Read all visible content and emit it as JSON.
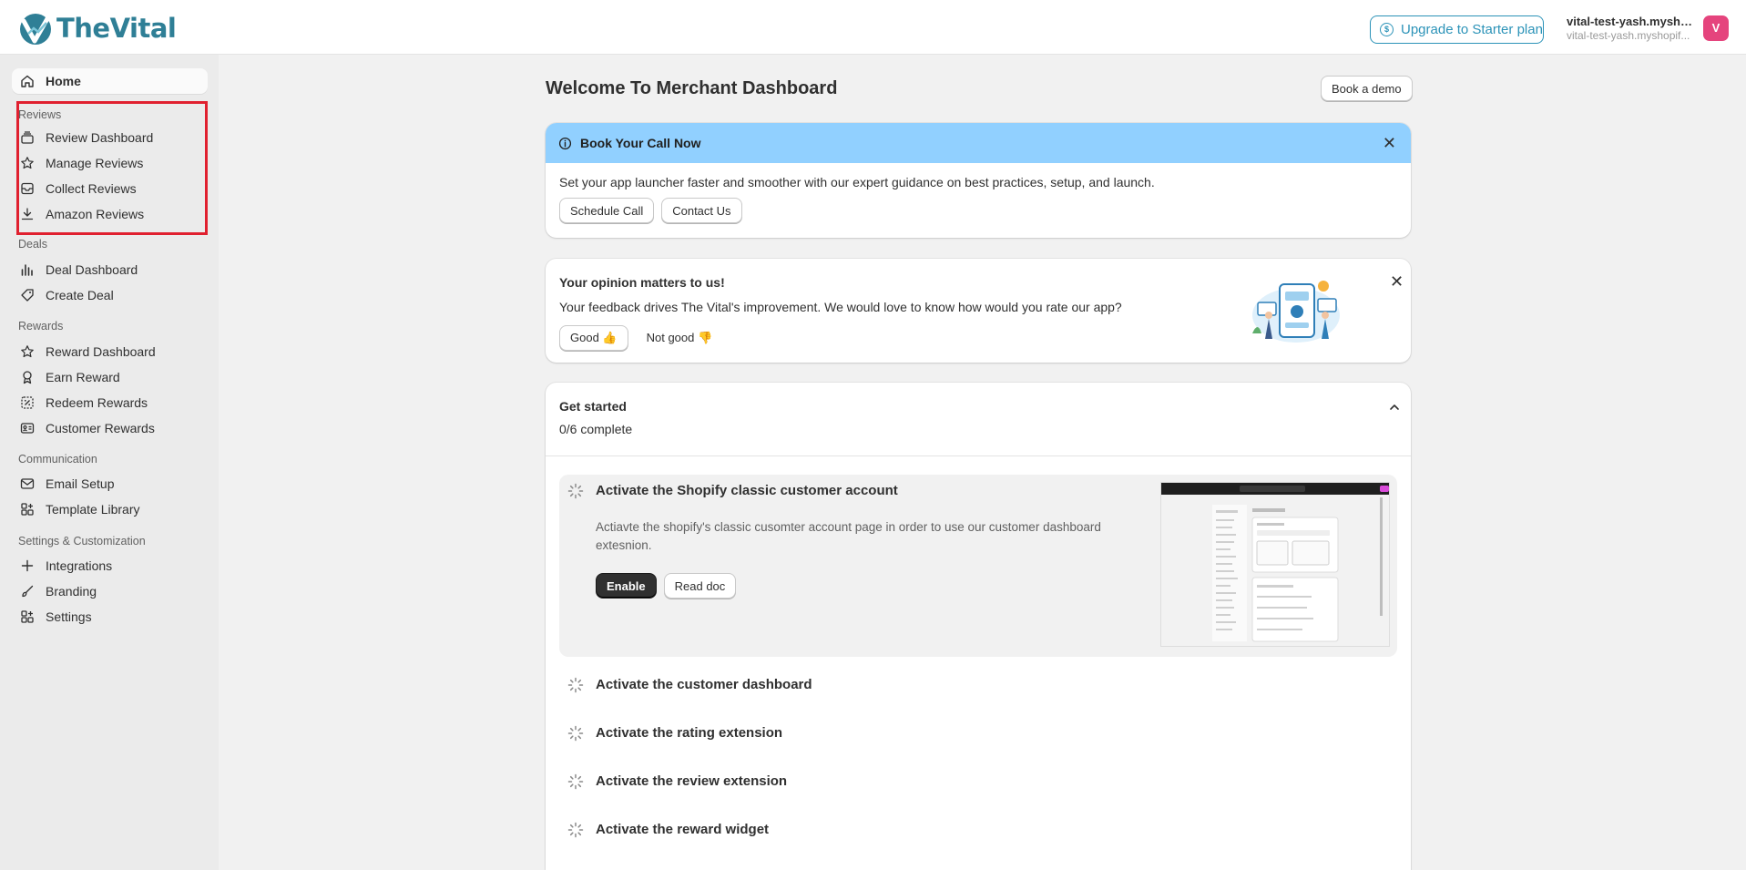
{
  "header": {
    "brand": "TheVital",
    "upgrade_label": "Upgrade to Starter plan",
    "store_name": "vital-test-yash.mysho...",
    "store_domain": "vital-test-yash.myshopif...",
    "avatar_initial": "V"
  },
  "sidebar": {
    "home": "Home",
    "reviews_section": "Reviews",
    "review_dashboard": "Review Dashboard",
    "manage_reviews": "Manage Reviews",
    "collect_reviews": "Collect Reviews",
    "amazon_reviews": "Amazon Reviews",
    "deals_section": "Deals",
    "deal_dashboard": "Deal Dashboard",
    "create_deal": "Create Deal",
    "rewards_section": "Rewards",
    "reward_dashboard": "Reward Dashboard",
    "earn_reward": "Earn Reward",
    "redeem_rewards": "Redeem Rewards",
    "customer_rewards": "Customer Rewards",
    "communication_section": "Communication",
    "email_setup": "Email Setup",
    "template_library": "Template Library",
    "settings_section": "Settings & Customization",
    "integrations": "Integrations",
    "branding": "Branding",
    "settings": "Settings"
  },
  "main": {
    "title": "Welcome To Merchant Dashboard",
    "book_demo": "Book a demo",
    "banner": {
      "title": "Book Your Call Now",
      "text": "Set your app launcher faster and smoother with our expert guidance on best practices, setup, and launch.",
      "schedule_call": "Schedule Call",
      "contact_us": "Contact Us"
    },
    "opinion": {
      "title": "Your opinion matters to us!",
      "text": "Your feedback drives The Vital's improvement. We would love to know how would you rate our app?",
      "good": "Good 👍",
      "not_good": "Not good 👎"
    },
    "get_started": {
      "title": "Get started",
      "progress": "0/6 complete",
      "steps": [
        {
          "title": "Activate the Shopify classic customer account",
          "description": "Actiavte the shopify's classic cusomter account page in order to use our customer dashboard extesnion.",
          "enable": "Enable",
          "read_doc": "Read doc"
        },
        {
          "title": "Activate the customer dashboard"
        },
        {
          "title": "Activate the rating extension"
        },
        {
          "title": "Activate the review extension"
        },
        {
          "title": "Activate the reward widget"
        }
      ]
    }
  }
}
